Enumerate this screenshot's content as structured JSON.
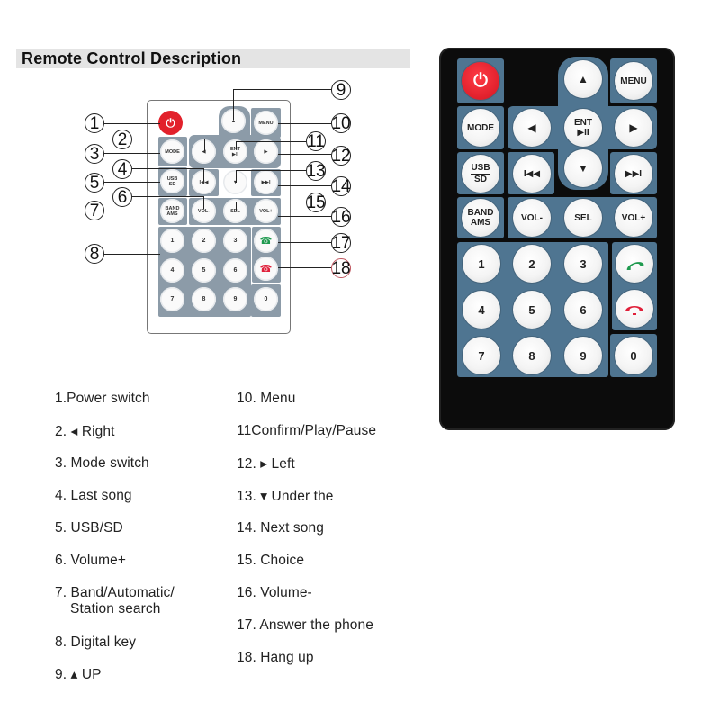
{
  "title": "Remote Control Description",
  "remote_buttons": {
    "power": "⏻",
    "up": "▲",
    "menu": "MENU",
    "mode": "MODE",
    "left_arrow": "◀",
    "ent": "ENT",
    "play_pause": "▶II",
    "right_arrow": "▶",
    "usb": "USB",
    "sd": "SD",
    "prev": "I◀◀",
    "down": "▼",
    "next": "▶▶I",
    "band": "BAND",
    "ams": "AMS",
    "vol_minus": "VOL-",
    "sel": "SEL",
    "vol_plus": "VOL+",
    "digits": [
      "1",
      "2",
      "3",
      "4",
      "5",
      "6",
      "7",
      "8",
      "9",
      "0"
    ],
    "answer": "📞",
    "hangup": "📞"
  },
  "colors": {
    "power_red": "#e2212b",
    "answer_green": "#1f9a4f",
    "hangup_red": "#e0203a",
    "panel_blue": "#4f7591",
    "diagram_panel_gray": "#8c9ba8",
    "remote_body": "#0c0c0c"
  },
  "callouts": [
    "1",
    "2",
    "3",
    "4",
    "5",
    "6",
    "7",
    "8",
    "9",
    "10",
    "11",
    "12",
    "13",
    "14",
    "15",
    "16",
    "17",
    "18"
  ],
  "legend": {
    "left": [
      "1.Power switch",
      "2. ◂ Right",
      "3. Mode switch",
      "4. Last song",
      "5. USB/SD",
      "6. Volume+",
      "7. Band/Automatic/",
      "Station search",
      "8. Digital key",
      "9. ▴ UP"
    ],
    "right": [
      "10. Menu",
      "11Confirm/Play/Pause",
      "12. ▸  Left",
      "13. ▾  Under the",
      "14. Next song",
      "15. Choice",
      "16. Volume-",
      "17. Answer the phone",
      "18. Hang up"
    ]
  }
}
